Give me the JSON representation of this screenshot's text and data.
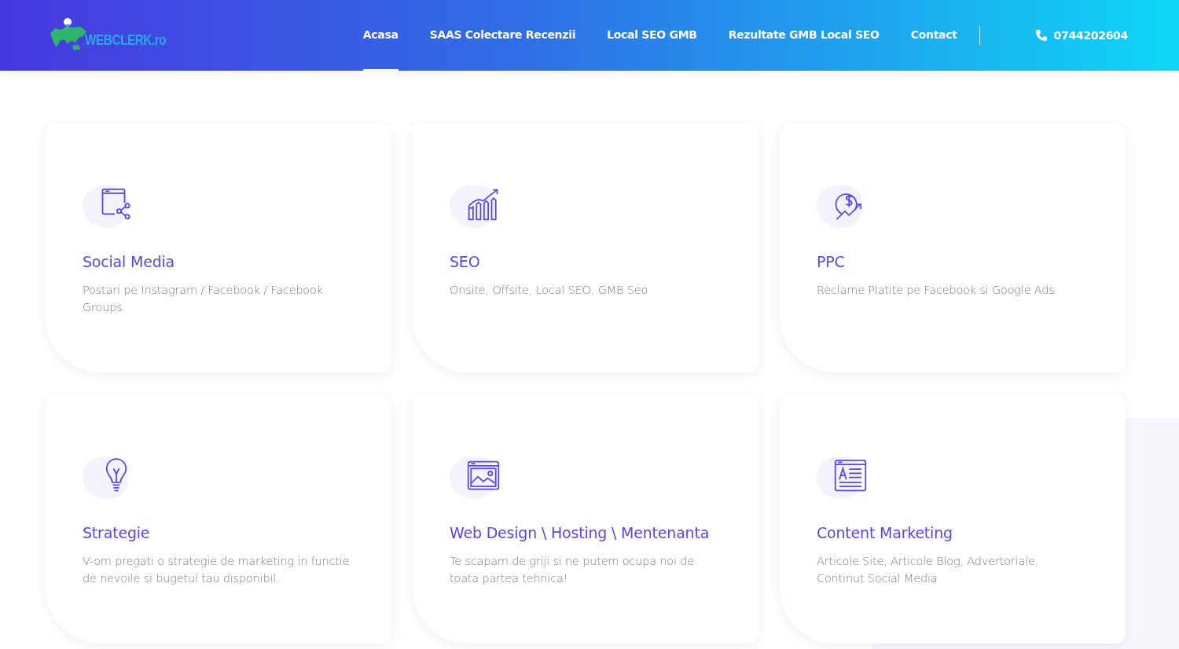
{
  "header": {
    "logo_text": "WEBCLERK.ro",
    "nav": [
      {
        "label": "Acasa",
        "selected": true
      },
      {
        "label": "SAAS Colectare Recenzii",
        "selected": false
      },
      {
        "label": "Local SEO GMB",
        "selected": false
      },
      {
        "label": "Rezultate GMB Local SEO",
        "selected": false
      },
      {
        "label": "Contact",
        "selected": false
      }
    ],
    "phone": "0744202604"
  },
  "services": [
    {
      "kind": "social",
      "title": "Social Media",
      "description": "Postari pe Instagram / Facebook / Facebook Groups"
    },
    {
      "kind": "seo",
      "title": "SEO",
      "description": "Onsite, Offsite, Local SEO, GMB Seo"
    },
    {
      "kind": "ppc",
      "title": "PPC",
      "description": "Reclame Platite pe Facebook si Google Ads"
    },
    {
      "kind": "idea",
      "title": "Strategie",
      "description": "V-om pregati o strategie de marketing in functie de nevoile si bugetul tau disponibil."
    },
    {
      "kind": "web",
      "title": "Web Design \\ Hosting \\ Mentenanta",
      "description": "Te scapam de griji si ne putem ocupa noi de toata partea tehnica!"
    },
    {
      "kind": "content",
      "title": "Content Marketing",
      "description": "Articole Site, Articole Blog, Advertoriale, Continut Social Media"
    }
  ]
}
